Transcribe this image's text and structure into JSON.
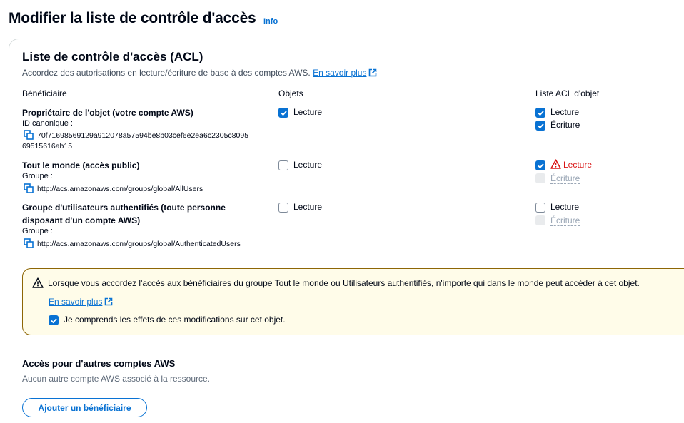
{
  "page": {
    "title": "Modifier la liste de contrôle d'accès",
    "info_label": "Info"
  },
  "acl": {
    "title": "Liste de contrôle d'accès (ACL)",
    "description": "Accordez des autorisations en lecture/écriture de base à des comptes AWS.",
    "learn_more": "En savoir plus",
    "columns": {
      "grantee": "Bénéficiaire",
      "objects": "Objets",
      "object_acl": "Liste ACL d'objet"
    },
    "rows": [
      {
        "name": "Propriétaire de l'objet (votre compte AWS)",
        "sub_label": "ID canonique :",
        "id_line1": "70f71698569129a912078a57594be8b03cef6e2ea6c2305c8095",
        "id_line2": "69515616ab15",
        "objects_read": {
          "label": "Lecture",
          "checked": true
        },
        "acl_read": {
          "label": "Lecture",
          "checked": true
        },
        "acl_write": {
          "label": "Écriture",
          "checked": true
        }
      },
      {
        "name": "Tout le monde (accès public)",
        "sub_label": "Groupe :",
        "id_line1": "http://acs.amazonaws.com/groups/global/AllUsers",
        "objects_read": {
          "label": "Lecture",
          "checked": false
        },
        "acl_read": {
          "label": "Lecture",
          "checked": true,
          "warning": true
        },
        "acl_write": {
          "label": "Écriture",
          "checked": false,
          "disabled": true
        }
      },
      {
        "name_line1": "Groupe d'utilisateurs authentifiés (toute personne",
        "name_line2": "disposant d'un compte AWS)",
        "sub_label": "Groupe :",
        "id_line1": "http://acs.amazonaws.com/groups/global/AuthenticatedUsers",
        "objects_read": {
          "label": "Lecture",
          "checked": false
        },
        "acl_read": {
          "label": "Lecture",
          "checked": false
        },
        "acl_write": {
          "label": "Écriture",
          "checked": false,
          "disabled": true
        }
      }
    ]
  },
  "alert": {
    "message": "Lorsque vous accordez l'accès aux bénéficiaires du groupe Tout le monde ou Utilisateurs authentifiés, n'importe qui dans le monde peut accéder à cet objet.",
    "learn_more": "En savoir plus",
    "ack_label": "Je comprends les effets de ces modifications sur cet objet.",
    "ack_checked": true
  },
  "other_accounts": {
    "title": "Accès pour d'autres comptes AWS",
    "description": "Aucun autre compte AWS associé à la ressource.",
    "add_button": "Ajouter un bénéficiaire"
  },
  "colors": {
    "accent": "#0972d3",
    "warning": "#d91515",
    "alert_bg": "#fffce9",
    "alert_border": "#8d6605"
  },
  "icons": [
    "external-link-icon",
    "copy-icon",
    "checkbox-checked",
    "warning-triangle-icon"
  ]
}
